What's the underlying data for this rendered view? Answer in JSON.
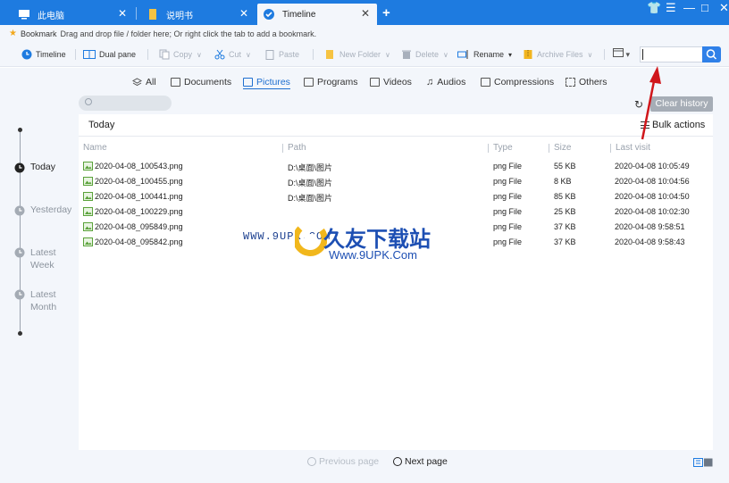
{
  "tabs": [
    {
      "label": "此电脑",
      "icon": "computer-icon"
    },
    {
      "label": "说明书",
      "icon": "document-icon"
    },
    {
      "label": "Timeline",
      "icon": "timeline-icon",
      "active": true
    }
  ],
  "window_controls": {
    "shirt": "👕",
    "menu": "☰",
    "minimize": "—",
    "maximize": "□",
    "close": "✕"
  },
  "bookmark": {
    "label": "Bookmark",
    "hint": "Drag and drop file / folder here; Or right click the tab to add a bookmark."
  },
  "toolbar": {
    "timeline": "Timeline",
    "dual_pane": "Dual pane",
    "copy": "Copy",
    "cut": "Cut",
    "paste": "Paste",
    "new_folder": "New Folder",
    "delete": "Delete",
    "rename": "Rename",
    "archive": "Archive Files"
  },
  "categories": [
    "All",
    "Documents",
    "Pictures",
    "Programs",
    "Videos",
    "Audios",
    "Compressions",
    "Others"
  ],
  "active_category": "Pictures",
  "clear_history": "Clear history",
  "section_title": "Today",
  "bulk_actions": "Bulk actions",
  "columns": {
    "name": "Name",
    "path": "Path",
    "type": "Type",
    "size": "Size",
    "last_visit": "Last visit"
  },
  "rows": [
    {
      "name": "2020-04-08_100543.png",
      "path": "D:\\桌面\\图片",
      "type": "png File",
      "size": "55 KB",
      "visit": "2020-04-08 10:05:49"
    },
    {
      "name": "2020-04-08_100455.png",
      "path": "D:\\桌面\\图片",
      "type": "png File",
      "size": "8 KB",
      "visit": "2020-04-08 10:04:56"
    },
    {
      "name": "2020-04-08_100441.png",
      "path": "D:\\桌面\\图片",
      "type": "png File",
      "size": "85 KB",
      "visit": "2020-04-08 10:04:50"
    },
    {
      "name": "2020-04-08_100229.png",
      "path": "",
      "type": "png File",
      "size": "25 KB",
      "visit": "2020-04-08 10:02:30"
    },
    {
      "name": "2020-04-08_095849.png",
      "path": "",
      "type": "png File",
      "size": "37 KB",
      "visit": "2020-04-08 9:58:51"
    },
    {
      "name": "2020-04-08_095842.png",
      "path": "",
      "type": "png File",
      "size": "37 KB",
      "visit": "2020-04-08 9:58:43"
    }
  ],
  "timeline": {
    "today": "Today",
    "yesterday": "Yesterday",
    "latest_week_1": "Latest",
    "latest_week_2": "Week",
    "latest_month_1": "Latest",
    "latest_month_2": "Month"
  },
  "pager": {
    "prev": "Previous page",
    "next": "Next page"
  },
  "watermark": {
    "small": "WWW.9UPK.COM",
    "big": "久友下载站",
    "url": "Www.9UPK.Com"
  },
  "colors": {
    "accent": "#1e7be0",
    "active_tab_bg": "#f3f6fb",
    "arrow": "#d0161b"
  }
}
